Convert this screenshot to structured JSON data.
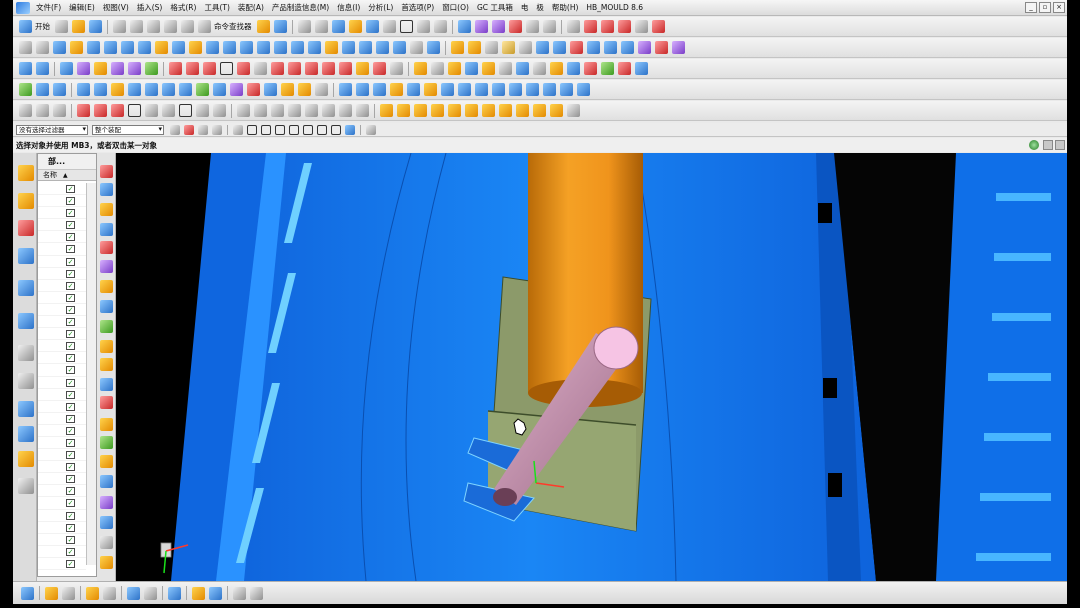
{
  "app": {
    "menu": [
      "文件(F)",
      "编辑(E)",
      "视图(V)",
      "插入(S)",
      "格式(R)",
      "工具(T)",
      "装配(A)",
      "产品制造信息(M)",
      "信息(I)",
      "分析(L)",
      "首选项(P)",
      "窗口(O)",
      "GC 工具箱",
      "电",
      "极",
      "帮助(H)",
      "HB_MOULD 8.6"
    ]
  },
  "toolbar": {
    "start_label": "开始",
    "command_finder_label": "命令查找器"
  },
  "selection_bar": {
    "filter_value": "没有选择过滤器",
    "scope_value": "整个装配"
  },
  "status": {
    "prompt": "选择对象并使用 MB3，或者双击某一对象"
  },
  "navigator": {
    "title": "部...",
    "column_name": "名称",
    "rows": [
      "✓",
      "✓",
      "✓",
      "✓",
      "✓",
      "✓",
      "✓",
      "✓",
      "✓",
      "✓",
      "✓",
      "✓",
      "✓",
      "✓",
      "✓",
      "✓",
      "✓",
      "✓",
      "✓",
      "✓",
      "✓",
      "✓",
      "✓",
      "✓",
      "✓",
      "✓",
      "✓",
      "✓",
      "✓",
      "✓",
      "✓",
      "✓"
    ]
  },
  "colors": {
    "mold_blue": "#1a7df0",
    "core_pin_orange": "#f0941c",
    "slider_block_khaki": "#8c9a6a",
    "ejector_rod_pink": "#c78fb0",
    "background": "#000000"
  }
}
